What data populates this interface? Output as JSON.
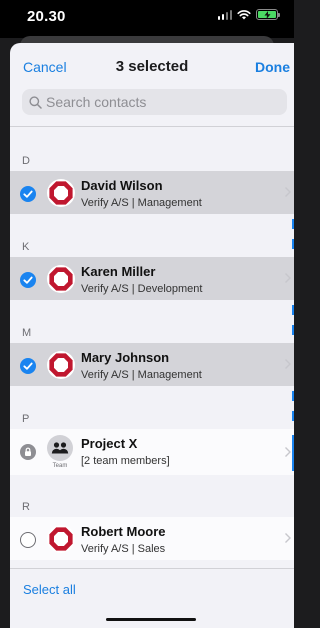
{
  "status_bar": {
    "time": "20.30",
    "battery_color": "#4cd964"
  },
  "nav": {
    "cancel": "Cancel",
    "title": "3 selected",
    "done": "Done"
  },
  "search": {
    "placeholder": "Search contacts"
  },
  "sections": [
    {
      "letter": "D",
      "contact": {
        "name": "David Wilson",
        "subtitle": "Verify A/S | Management",
        "selected": true
      }
    },
    {
      "letter": "K",
      "contact": {
        "name": "Karen Miller",
        "subtitle": "Verify A/S | Development",
        "selected": true
      }
    },
    {
      "letter": "M",
      "contact": {
        "name": "Mary Johnson",
        "subtitle": "Verify A/S | Management",
        "selected": true
      }
    },
    {
      "letter": "P",
      "contact": {
        "name": "Project X",
        "subtitle": "[2 team members]",
        "avatar_caption": "Team",
        "selected": false,
        "locked": true
      }
    },
    {
      "letter": "R",
      "contact": {
        "name": "Robert Moore",
        "subtitle": "Verify A/S | Sales",
        "selected": false
      }
    }
  ],
  "footer": {
    "select_all": "Select all"
  },
  "colors": {
    "accent": "#1a7fe0",
    "selected_row": "#d4d4d9",
    "logo_red": "#c0172f"
  },
  "icons": [
    "signal-icon",
    "wifi-icon",
    "battery-icon",
    "search-icon",
    "checkmark-icon",
    "lock-icon",
    "team-icon",
    "chevron-right-icon",
    "verify-logo"
  ]
}
